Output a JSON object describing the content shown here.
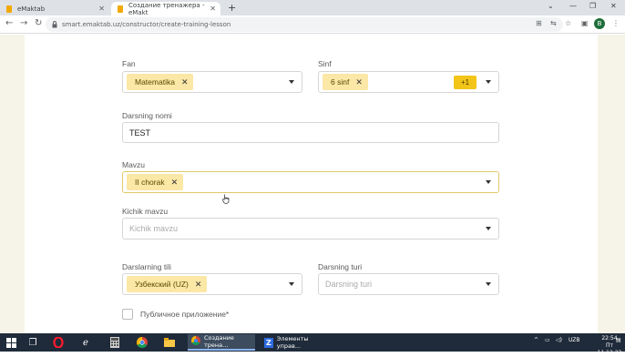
{
  "browser": {
    "tabs": [
      {
        "title": "eMaktab"
      },
      {
        "title": "Создание тренажера - eMakt"
      }
    ],
    "url": "smart.emaktab.uz/constructor/create-training-lesson",
    "profile_initial": "B"
  },
  "form": {
    "fan": {
      "label": "Fan",
      "chip": "Matematika"
    },
    "sinf": {
      "label": "Sinf",
      "chip": "6 sinf",
      "more_badge": "+1"
    },
    "darsning_nomi": {
      "label": "Darsning nomi",
      "value": "TEST"
    },
    "mavzu": {
      "label": "Mavzu",
      "chip": "II chorak"
    },
    "kichik_mavzu": {
      "label": "Kichik mavzu",
      "placeholder": "Kichik mavzu"
    },
    "darslarning_tili": {
      "label": "Darslarning tili",
      "chip": "Узбекский (UZ)"
    },
    "darsning_turi": {
      "label": "Darsning turi",
      "placeholder": "Darsning turi"
    },
    "public_app": {
      "label": "Публичное приложение*",
      "checked": false
    }
  },
  "taskbar": {
    "apps": [
      {
        "label": "Создание трена..."
      },
      {
        "label": "Элементы управ..."
      }
    ],
    "language": "UZB",
    "time": "22:54",
    "date": "Пт 11.12.23"
  },
  "colors": {
    "chip_bg": "#fbe7a6",
    "badge": "#f2c518",
    "side_panel": "#f6f4e8"
  }
}
